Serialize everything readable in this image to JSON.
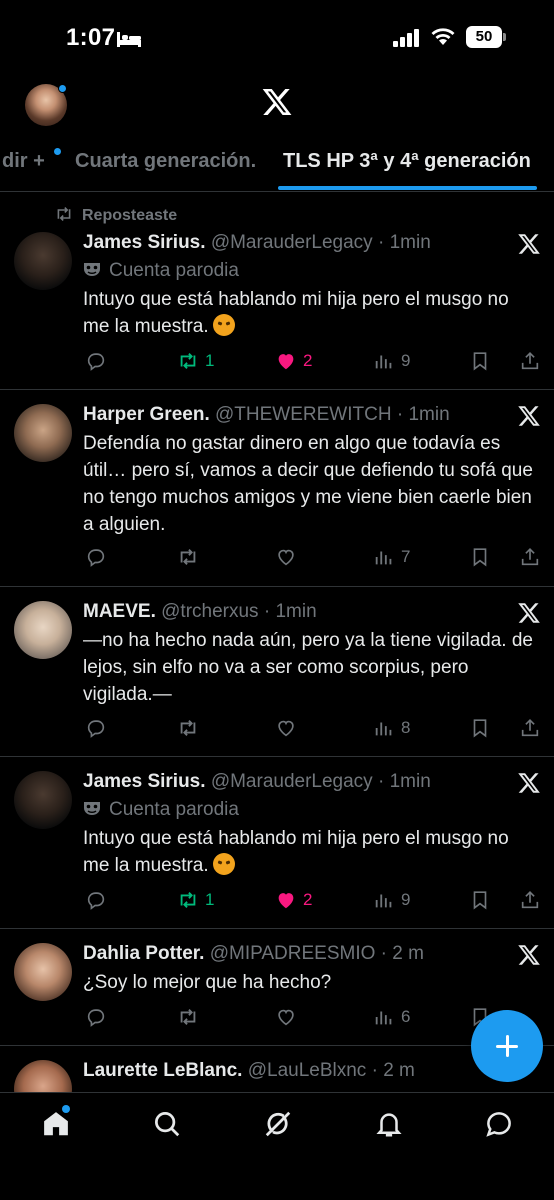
{
  "status_bar": {
    "time": "1:07",
    "battery": "50",
    "icons": [
      "bed-icon",
      "signal-icon",
      "wifi-icon",
      "battery-icon"
    ]
  },
  "header": {
    "logo": "x-logo-icon"
  },
  "tabs": [
    {
      "label": "dir +",
      "active": false
    },
    {
      "label": "Cuarta generación.",
      "active": false
    },
    {
      "label": "TLS HP 3ª y 4ª generación",
      "active": true
    }
  ],
  "reposted_label": "Reposteaste",
  "parody_label": "Cuenta parodia",
  "tweets": [
    {
      "name": "James Sirius.",
      "handle": "@MarauderLegacy",
      "time": "· 1min",
      "parody": true,
      "text": "Intuyo que está hablando mi hija pero el musgo no me la muestra.",
      "emoji": "angry-face",
      "replies": "",
      "reposts": "1",
      "likes": "2",
      "views": "9",
      "reposted_by_me": true,
      "liked": true
    },
    {
      "name": "Harper Green.",
      "handle": "@THEWEREWITCH",
      "time": "· 1min",
      "parody": false,
      "text": "Defendía no gastar dinero en algo que todavía es útil… pero sí, vamos a decir que defiendo tu sofá que no tengo muchos amigos y me viene bien caerle bien a alguien.",
      "replies": "",
      "reposts": "",
      "likes": "",
      "views": "7"
    },
    {
      "name": "MAEVE.",
      "handle": "@trcherxus",
      "time": "· 1min",
      "parody": false,
      "text": "—no ha hecho nada aún, pero ya la tiene vigilada. de lejos, sin elfo no va a ser como scorpius, pero vigilada.—",
      "replies": "",
      "reposts": "",
      "likes": "",
      "views": "8"
    },
    {
      "name": "James Sirius.",
      "handle": "@MarauderLegacy",
      "time": "· 1min",
      "parody": true,
      "text": "Intuyo que está hablando mi hija pero el musgo no me la muestra.",
      "emoji": "angry-face",
      "replies": "",
      "reposts": "1",
      "likes": "2",
      "views": "9",
      "reposted_by_me": true,
      "liked": true
    },
    {
      "name": "Dahlia Potter.",
      "handle": "@MIPADREESMIO",
      "time": "· 2 m",
      "parody": false,
      "text": "¿Soy lo mejor que ha hecho?",
      "replies": "",
      "reposts": "",
      "likes": "",
      "views": "6"
    },
    {
      "name": "Laurette LeBlanc.",
      "handle": "@LauLeBlxnc",
      "time": "· 2 m",
      "parody": false
    }
  ],
  "bottom_nav": [
    "home-icon",
    "search-icon",
    "grok-icon",
    "notifications-icon",
    "messages-icon"
  ],
  "colors": {
    "background": "#000000",
    "accent": "#1d9bf0",
    "text": "#e7e9ea",
    "muted": "#71767b",
    "repost_green": "#00ba7c",
    "like_pink": "#f91880",
    "divider": "#2f3336"
  }
}
